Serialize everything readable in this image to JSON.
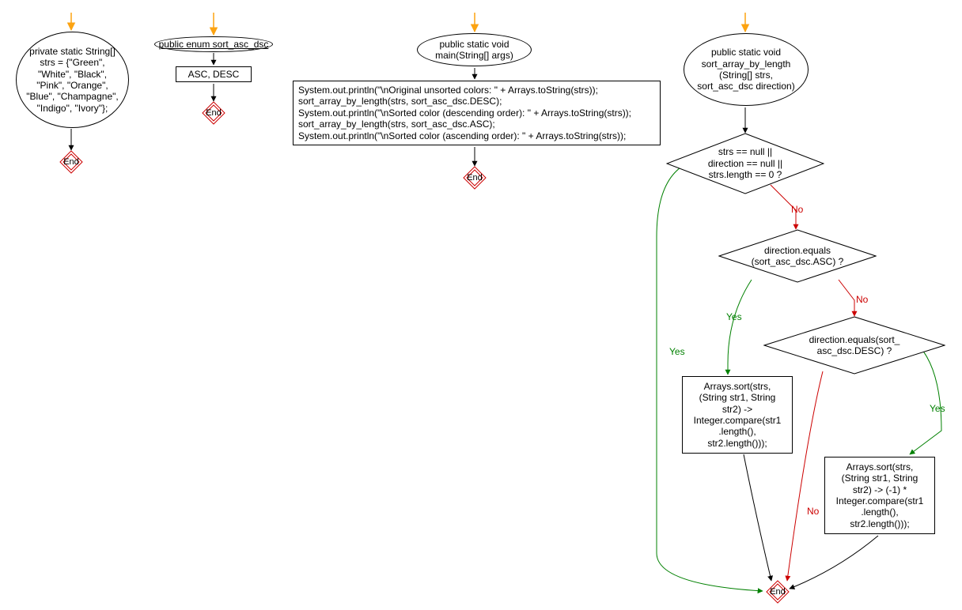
{
  "nodes": {
    "strs_decl": "private static String[]\nstrs = {\"Green\",\n\"White\", \"Black\",\n\"Pink\", \"Orange\",\n\"Blue\", \"Champagne\",\n\"Indigo\", \"Ivory\"};",
    "enum_decl": "public enum sort_asc_dsc",
    "asc_desc": "ASC, DESC",
    "main_decl": "public static void\nmain(String[] args)",
    "main_body": "System.out.println(\"\\nOriginal unsorted colors: \" + Arrays.toString(strs));\nsort_array_by_length(strs, sort_asc_dsc.DESC);\nSystem.out.println(\"\\nSorted color (descending order): \" + Arrays.toString(strs));\nsort_array_by_length(strs, sort_asc_dsc.ASC);\nSystem.out.println(\"\\nSorted color (ascending order): \" + Arrays.toString(strs));",
    "sort_decl": "public static void\nsort_array_by_length\n(String[] strs,\nsort_asc_dsc direction)",
    "cond_null": "strs == null ||\ndirection == null ||\nstrs.length == 0 ?",
    "cond_asc": "direction.equals\n(sort_asc_dsc.ASC) ?",
    "cond_desc": "direction.equals(sort_\nasc_dsc.DESC) ?",
    "sort_asc_body": "Arrays.sort(strs,\n(String str1, String\nstr2) ->\nInteger.compare(str1\n.length(),\nstr2.length()));",
    "sort_desc_body": "Arrays.sort(strs,\n(String str1, String\nstr2) -> (-1) *\nInteger.compare(str1\n.length(),\nstr2.length()));",
    "end": "End"
  },
  "labels": {
    "yes": "Yes",
    "no": "No"
  },
  "colors": {
    "yes": "#008000",
    "no": "#cc0000",
    "arrow": "#000000",
    "entry": "#fca311"
  }
}
